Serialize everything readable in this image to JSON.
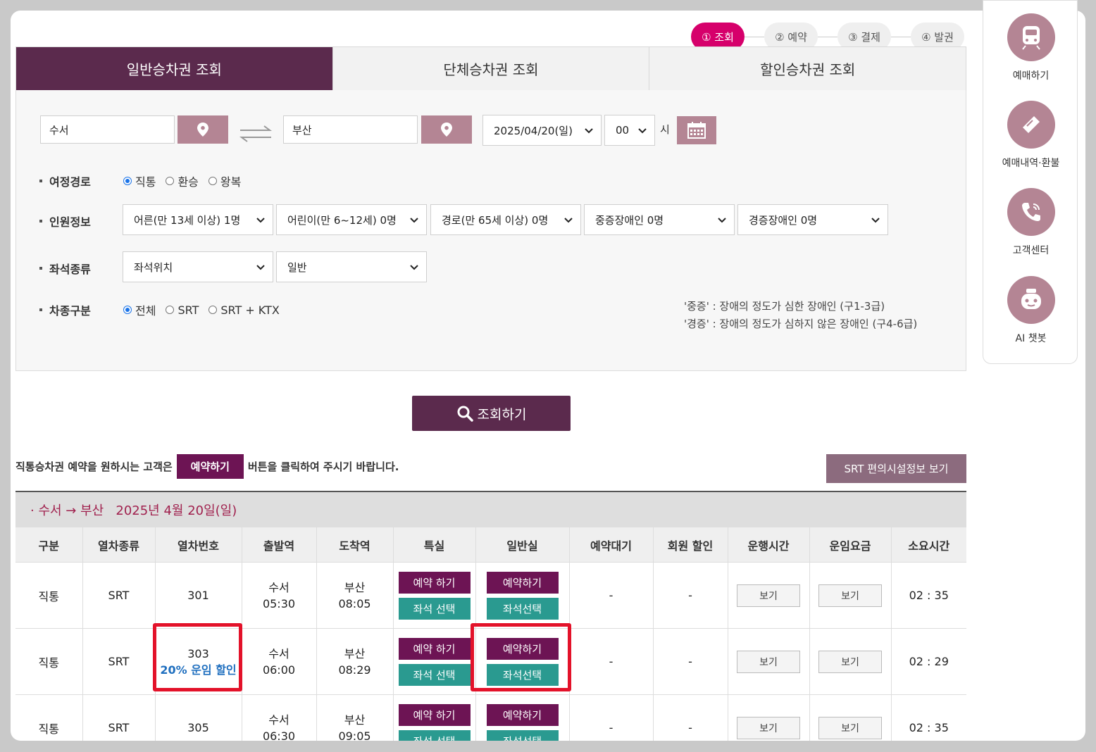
{
  "steps": [
    "① 조회",
    "② 예약",
    "③ 결제",
    "④ 발권"
  ],
  "tabs": [
    "일반승차권 조회",
    "단체승차권 조회",
    "할인승차권 조회"
  ],
  "search": {
    "departure": "수서",
    "arrival": "부산",
    "date": "2025/04/20(일)",
    "hour": "00",
    "hour_unit": "시"
  },
  "labels": {
    "route": "여정경로",
    "passengers": "인원정보",
    "seat": "좌석종류",
    "train_type": "차종구분"
  },
  "route_options": [
    "직통",
    "환승",
    "왕복"
  ],
  "passenger_selects": [
    "어른(만 13세 이상) 1명",
    "어린이(만 6~12세) 0명",
    "경로(만 65세 이상) 0명",
    "중증장애인 0명",
    "경증장애인 0명"
  ],
  "seat_selects": [
    "좌석위치",
    "일반"
  ],
  "train_type_options": [
    "전체",
    "SRT",
    "SRT + KTX"
  ],
  "notes": [
    "'중증' : 장애의 정도가 심한 장애인 (구1-3급)",
    "'경증' : 장애의 정도가 심하지 않은 장애인 (구4-6급)"
  ],
  "search_button": "조회하기",
  "notice": {
    "before": "직통승차권 예약을 원하시는 고객은",
    "tag": "예약하기",
    "after": "버튼을 클릭하여 주시기 바랍니다."
  },
  "facility_button": "SRT 편의시설정보 보기",
  "route_title": "· 수서 → 부산   2025년 4월 20일(일)",
  "table": {
    "headers": [
      "구분",
      "열차종류",
      "열차번호",
      "출발역",
      "도착역",
      "특실",
      "일반실",
      "예약대기",
      "회원 할인",
      "운행시간",
      "운임요금",
      "소요시간"
    ],
    "rows": [
      {
        "type": "직통",
        "kind": "SRT",
        "number": "301",
        "discount": "",
        "dep_station": "수서",
        "dep_time": "05:30",
        "arr_station": "부산",
        "arr_time": "08:05",
        "first_reserve": "예약 하기",
        "first_seat": "좌석 선택",
        "std_reserve": "예약하기",
        "std_seat": "좌석선택",
        "waitlist": "-",
        "member_discount": "-",
        "schedule": "보기",
        "fare": "보기",
        "duration": "02 : 35"
      },
      {
        "type": "직통",
        "kind": "SRT",
        "number": "303",
        "discount": "20% 운임 할인",
        "dep_station": "수서",
        "dep_time": "06:00",
        "arr_station": "부산",
        "arr_time": "08:29",
        "first_reserve": "예약 하기",
        "first_seat": "좌석 선택",
        "std_reserve": "예약하기",
        "std_seat": "좌석선택",
        "waitlist": "-",
        "member_discount": "-",
        "schedule": "보기",
        "fare": "보기",
        "duration": "02 : 29"
      },
      {
        "type": "직통",
        "kind": "SRT",
        "number": "305",
        "discount": "",
        "dep_station": "수서",
        "dep_time": "06:30",
        "arr_station": "부산",
        "arr_time": "09:05",
        "first_reserve": "예약 하기",
        "first_seat": "좌석 선택",
        "std_reserve": "예약하기",
        "std_seat": "좌석선택",
        "waitlist": "-",
        "member_discount": "-",
        "schedule": "보기",
        "fare": "보기",
        "duration": "02 : 35"
      }
    ]
  },
  "quick_menu": [
    "예매하기",
    "예매내역·환불",
    "고객센터",
    "AI 챗봇"
  ],
  "colors": {
    "accent": "#5b2a4d",
    "active_step": "#d6006b",
    "reserve": "#6d1454",
    "seat": "#2a9a90",
    "highlight": "#e3122a"
  }
}
